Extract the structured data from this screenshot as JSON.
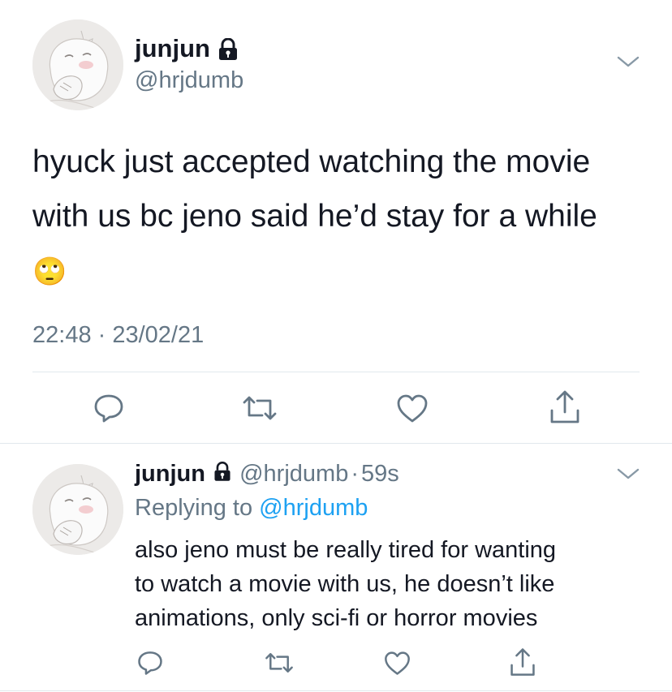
{
  "main_tweet": {
    "display_name": "junjun",
    "handle": "@hrjdumb",
    "text": "hyuck just accepted watching the movie with us bc jeno said he’d stay for a while",
    "emoji": "🙄",
    "timestamp": "22:48 · 23/02/21",
    "icons": [
      "lock-icon",
      "chevron-down-icon",
      "reply-icon",
      "retweet-icon",
      "like-icon",
      "share-icon"
    ]
  },
  "reply_tweet": {
    "display_name": "junjun",
    "handle": "@hrjdumb",
    "separator": "·",
    "time_ago": "59s",
    "replying_prefix": "Replying to",
    "replying_to": "@hrjdumb",
    "text_lines": [
      "also jeno must be really tired for wanting",
      "to watch a movie with us, he doesn’t like",
      "animations, only sci-fi or horror movies"
    ]
  },
  "colors": {
    "text": "#141823",
    "secondary": "#657786",
    "link": "#1da1f2",
    "divider": "#e1e8ed"
  }
}
